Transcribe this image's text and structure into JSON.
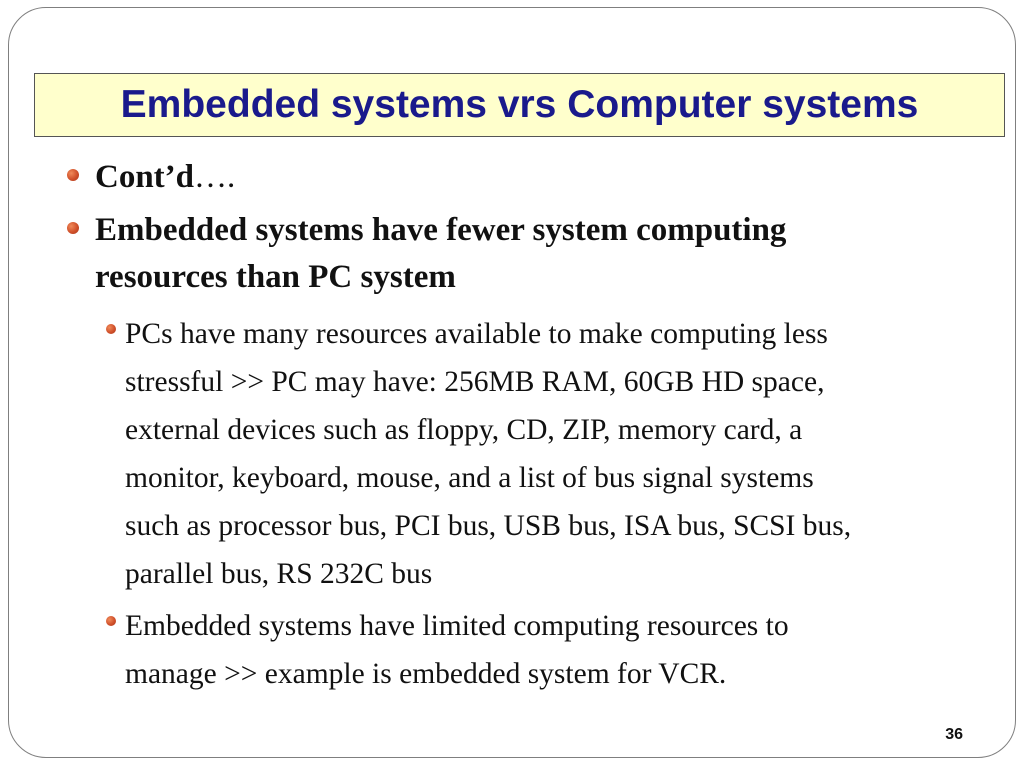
{
  "slide": {
    "title": "Embedded systems vrs Computer systems",
    "bullets": [
      {
        "bold_text": "Cont’d",
        "tail_text": "…."
      },
      {
        "line1": "Embedded systems have fewer system computing",
        "line2": "resources than PC system"
      }
    ],
    "sub_bullets": [
      {
        "lines": [
          "PCs have many resources available to make computing less",
          "stressful >> PC may have: 256MB RAM, 60GB HD space,",
          "external devices such as floppy, CD, ZIP, memory card, a",
          "monitor, keyboard, mouse, and a list of bus signal systems",
          "such as processor bus, PCI bus, USB bus, ISA bus, SCSI bus,",
          "parallel bus, RS 232C bus"
        ]
      },
      {
        "lines": [
          "Embedded systems have limited computing resources to",
          "manage >> example is embedded system for VCR."
        ]
      }
    ],
    "page_number": "36"
  },
  "colors": {
    "title_text": "#1a1a8c",
    "title_background": "#ffffcc",
    "bullet": "#d0502a",
    "body_text": "#111111"
  }
}
